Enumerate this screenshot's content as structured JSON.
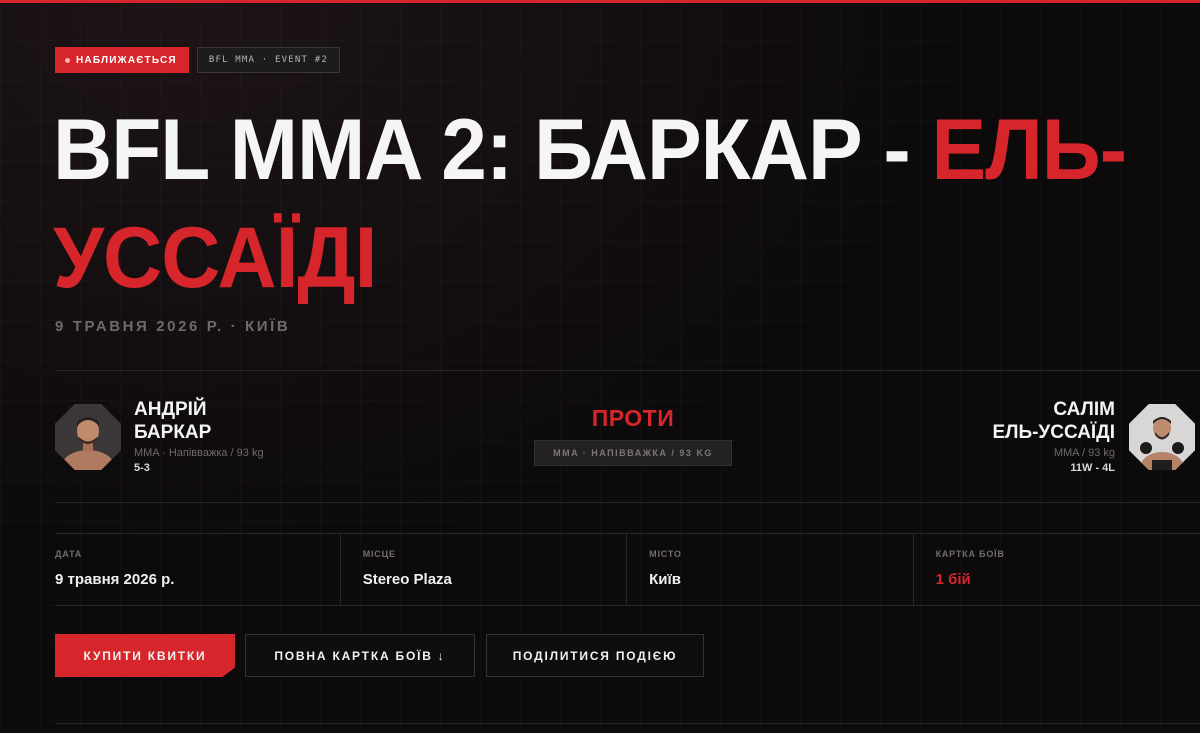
{
  "badges": {
    "status": "НАБЛИЖАЄТЬСЯ",
    "event": "BFL MMA · EVENT #2"
  },
  "title": {
    "white_part": "BFL MMA 2: БАРКАР - ",
    "red_part": "ЕЛЬ-УССАЇДІ"
  },
  "dateline": "9 ТРАВНЯ 2026 Р. · КИЇВ",
  "fighters": {
    "left": {
      "name_line1": "АНДРІЙ",
      "name_line2": "БАРКАР",
      "meta": "MMA · Напівважка / 93 kg",
      "record": "5-3"
    },
    "right": {
      "name_line1": "САЛІМ",
      "name_line2": "ЕЛЬ-УССАЇДІ",
      "meta": "MMA / 93 kg",
      "record": "11W - 4L"
    }
  },
  "versus": {
    "label": "ПРОТИ",
    "category": "MMA · НАПІВВАЖКА / 93 KG"
  },
  "info": [
    {
      "label": "ДАТА",
      "value": "9 травня 2026 р."
    },
    {
      "label": "МІСЦЕ",
      "value": "Stereo Plaza"
    },
    {
      "label": "МІСТО",
      "value": "Київ"
    },
    {
      "label": "КАРТКА БОЇВ",
      "value": "1 бій"
    }
  ],
  "buttons": {
    "buy": "КУПИТИ КВИТКИ",
    "full_card": "ПОВНА КАРТКА БОЇВ ↓",
    "share": "ПОДІЛИТИСЯ ПОДІЄЮ"
  },
  "colors": {
    "accent": "#d7262b",
    "background": "#0c0a0b"
  }
}
